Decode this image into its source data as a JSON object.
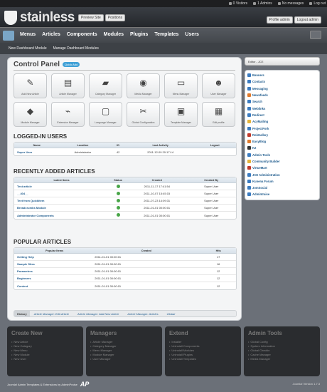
{
  "topbar": {
    "stats": [
      {
        "label": "0 Visitors",
        "icon": "user-icon"
      },
      {
        "label": "1 Admins",
        "icon": "admin-icon"
      },
      {
        "label": "No messages",
        "icon": "mail-icon"
      },
      {
        "label": "Log out",
        "icon": "logout-icon"
      }
    ]
  },
  "header": {
    "brand": "stainless",
    "buttons": [
      "Preview Site",
      "Positions"
    ],
    "right_buttons": [
      "Profile admin",
      "Logout admin"
    ]
  },
  "nav": {
    "items": [
      "Menus",
      "Articles",
      "Components",
      "Modules",
      "Plugins",
      "Templates",
      "Users"
    ],
    "accent": "#38a9d6"
  },
  "subnav": [
    "New Dashboard Module",
    "Manage Dashboard Modules"
  ],
  "control_panel": {
    "title": "Control Panel",
    "quick_add": "Quick Add",
    "icons": [
      {
        "label": "Add New Article",
        "glyph": "✎"
      },
      {
        "label": "Article Manager",
        "glyph": "▤"
      },
      {
        "label": "Category Manager",
        "glyph": "▰"
      },
      {
        "label": "Media Manager",
        "glyph": "◉"
      },
      {
        "label": "Menu Manager",
        "glyph": "▭"
      },
      {
        "label": "User Manager",
        "glyph": "☻"
      },
      {
        "label": "Module Manager",
        "glyph": "◆"
      },
      {
        "label": "Extension Manager",
        "glyph": "⌁"
      },
      {
        "label": "Language Manager",
        "glyph": "▢"
      },
      {
        "label": "Global Configuration",
        "glyph": "✂"
      },
      {
        "label": "Template Manager",
        "glyph": "▣"
      },
      {
        "label": "Edit profile",
        "glyph": "▦"
      }
    ]
  },
  "logged_in": {
    "title": "LOGGED-IN USERS",
    "headers": [
      "Name",
      "Location",
      "ID",
      "Last Activity",
      "Logout"
    ],
    "rows": [
      [
        "Super User",
        "Administrator",
        "42",
        "2011-12-09 20:17:14",
        ""
      ]
    ]
  },
  "recent": {
    "title": "RECENTLY ADDED ARTICLES",
    "headers": [
      "Latest Items",
      "Status",
      "Created",
      "Created By"
    ],
    "rows": [
      [
        "Test article",
        "2011-11-17 17:41:54",
        "Super User"
      ],
      [
        "__404__",
        "2011-10-07 15:45:15",
        "Super User"
      ],
      [
        "Text from Quickitem",
        "2011-07-23 14:09:31",
        "Super User"
      ],
      [
        "Breadcrumbs Module",
        "2011-01-01 00:00:01",
        "Super User"
      ],
      [
        "Administrator Components",
        "2011-01-01 00:00:01",
        "Super User"
      ]
    ]
  },
  "popular": {
    "title": "POPULAR ARTICLES",
    "headers": [
      "Popular Items",
      "Created",
      "Hits"
    ],
    "rows": [
      [
        "Getting Help",
        "2011-01-01 00:00:01",
        "17"
      ],
      [
        "Sample Sites",
        "2011-01-01 00:00:01",
        "16"
      ],
      [
        "Parameters",
        "2011-01-01 00:00:01",
        "12"
      ],
      [
        "Beginners",
        "2011-01-01 00:00:01",
        "12"
      ],
      [
        "Content",
        "2011-01-01 00:00:01",
        "12"
      ]
    ]
  },
  "history": {
    "label": "History",
    "crumbs": [
      "Article Manager: Edit Article",
      "Article Manager: Add New Article",
      "Article Manager: Articles",
      "Global"
    ]
  },
  "side": {
    "editor": "Editor - JCE",
    "items": [
      {
        "label": "Banners",
        "color": "#3b7bc0"
      },
      {
        "label": "Contacts",
        "color": "#3b7bc0"
      },
      {
        "label": "Messaging",
        "color": "#3b7bc0"
      },
      {
        "label": "Newsfeeds",
        "color": "#e07a2c"
      },
      {
        "label": "Search",
        "color": "#3b7bc0"
      },
      {
        "label": "Weblinks",
        "color": "#3b7bc0"
      },
      {
        "label": "Redirect",
        "color": "#3b7bc0"
      },
      {
        "label": "AcyMailing",
        "color": "#e5b33a"
      },
      {
        "label": "ProjectFork",
        "color": "#3b7bc0"
      },
      {
        "label": "RokGallery",
        "color": "#c0392b"
      },
      {
        "label": "EasyBlog",
        "color": "#e07a2c"
      },
      {
        "label": "K2",
        "color": "#333333"
      },
      {
        "label": "Admin Tools",
        "color": "#3b7bc0"
      },
      {
        "label": "Community Builder",
        "color": "#e5b33a"
      },
      {
        "label": "VirtueMart",
        "color": "#c0392b"
      },
      {
        "label": "JCE Administration",
        "color": "#3b7bc0"
      },
      {
        "label": "Kunena Forum",
        "color": "#3b7bc0"
      },
      {
        "label": "JomSocial",
        "color": "#3b7bc0"
      },
      {
        "label": "Admintraise",
        "color": "#3b7bc0"
      }
    ]
  },
  "footer": {
    "columns": [
      {
        "title": "Create New",
        "items": [
          "New Article",
          "New Category",
          "New Menu",
          "New Module",
          "New User"
        ]
      },
      {
        "title": "Managers",
        "items": [
          "Article Manager",
          "Category Manager",
          "Menu Manager",
          "Module Manager",
          "User Manager"
        ]
      },
      {
        "title": "Extend",
        "items": [
          "Installer",
          "Uninstall Components",
          "Uninstall Modules",
          "Uninstall Plugins",
          "Uninstall Templates"
        ]
      },
      {
        "title": "Admin Tools",
        "items": [
          "Global Config",
          "System Information",
          "Global Checkin",
          "Cache Manager",
          "Media Manager"
        ]
      }
    ],
    "copyright": "Joomla! Admin Templates & Extensions by AdminPraise",
    "logo": "AP",
    "version": "Joomla! Version 1.7.3"
  }
}
